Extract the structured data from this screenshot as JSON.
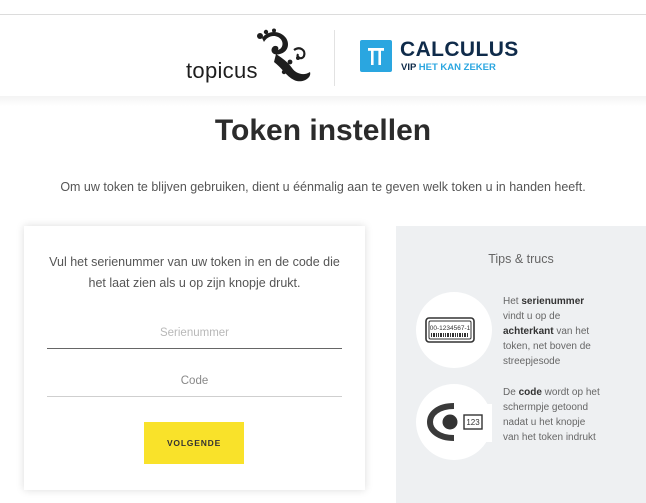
{
  "header": {
    "topicus_logo_text": "topicus",
    "calculus_logo_text": "CALCULUS",
    "calculus_tag_vip": "VIP",
    "calculus_tag_slogan": "HET KAN ZEKER",
    "brand_colors": {
      "calculus_blue": "#2aa6e0",
      "calculus_navy": "#0f2b4a"
    }
  },
  "page": {
    "title": "Token instellen",
    "subtitle": "Om uw token te blijven gebruiken, dient u éénmalig aan te geven welk token u in handen heeft."
  },
  "form": {
    "intro": "Vul het serienummer van uw token in en de code die het laat zien als u op zijn knopje drukt.",
    "serial_placeholder": "Serienummer",
    "serial_value": "",
    "code_placeholder": "Code",
    "code_value": "",
    "next_label": "VOLGENDE",
    "button_color": "#f9e22a"
  },
  "tips": {
    "title": "Tips & trucs",
    "serial_tip": {
      "icon": "token-serial-icon",
      "label": "00-1234567-1",
      "pre": "Het ",
      "bold1": "serienummer",
      "mid": " vindt u op de ",
      "bold2": "achterkant",
      "post": " van het token, net boven de streepjesode"
    },
    "code_tip": {
      "icon": "token-display-icon",
      "label": "123",
      "pre": "De ",
      "bold": "code",
      "post": " wordt op het schermpje getoond nadat u het knopje van het token indrukt"
    },
    "panel_color": "#eef0f2"
  }
}
